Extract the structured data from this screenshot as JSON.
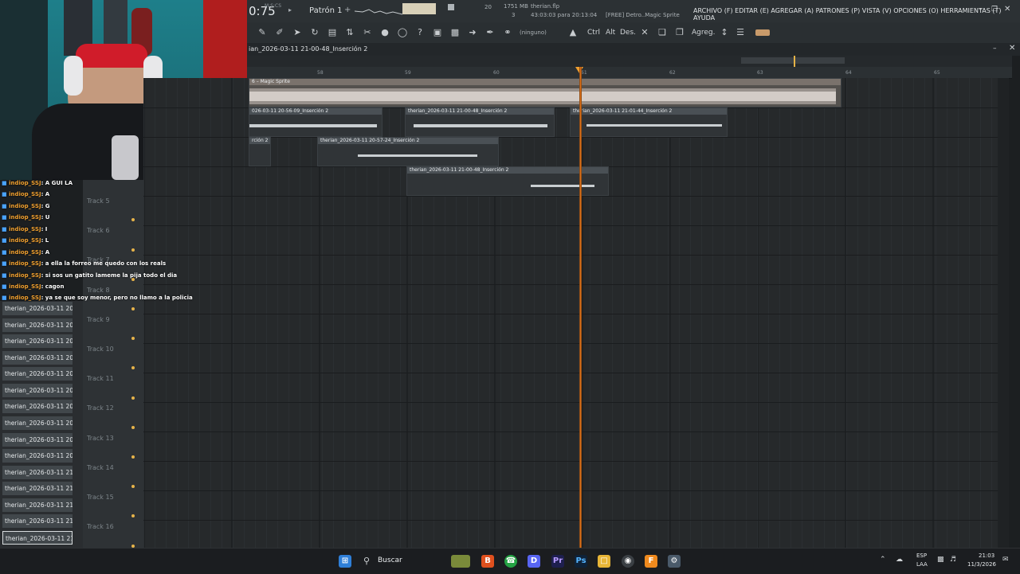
{
  "topbar": {
    "time": "0:75",
    "time_tag": "M:S:CS",
    "pattern": "Patrón 1",
    "pattern_add": "+",
    "cpu_num": "20",
    "memory": "1751 MB",
    "voices": "3",
    "file_name": "therian.flp",
    "file_time": "43:03:03 para 20:13:04",
    "plugin_info": "[FREE] Detro..Magic Sprite",
    "menu": "ARCHIVO (F) EDITAR (E) AGREGAR (A) PATRONES (P) VISTA (V) OPCIONES (O) HERRAMIENTAS (T) AYUDA"
  },
  "toolbar": {
    "mode": "(ninguno)",
    "ctrl": "Ctrl",
    "alt": "Alt",
    "des": "Des.",
    "agreg": "Agreg."
  },
  "playlist": {
    "title": "ian_2026-03-11 21-00-48_Inserción 2",
    "ruler": [
      "58",
      "59",
      "60",
      "61",
      "62",
      "63",
      "64",
      "65"
    ],
    "tracks": [
      "Track 5",
      "Track 6",
      "Track 7",
      "Track 8",
      "Track 9",
      "Track 10",
      "Track 11",
      "Track 12",
      "Track 13",
      "Track 14",
      "Track 15",
      "Track 16"
    ],
    "clips": {
      "magic": "6 – Magic Sprite",
      "c1": "026-03-11 20-56-09_Inserción 2",
      "c2": "therian_2026-03-11 21-00-48_Inserción 2",
      "c3": "therian_2026-03-11 21-01-44_Inserción 2",
      "c4": "rción 2",
      "c5": "therian_2026-03-11 20-57-24_Inserción 2",
      "c6": "therian_2026-03-11 21-00-48_Inserción 2"
    }
  },
  "browser": {
    "items": [
      "therian_2026-03-11 20-",
      "therian_2026-03-11 20-",
      "therian_2026-03-11 20-",
      "therian_2026-03-11 20-",
      "therian_2026-03-11 20-",
      "therian_2026-03-11 20-",
      "therian_2026-03-11 20-",
      "therian_2026-03-11 20-",
      "therian_2026-03-11 20-",
      "therian_2026-03-11 20-",
      "therian_2026-03-11 21-",
      "therian_2026-03-11 21-",
      "therian_2026-03-11 21-",
      "therian_2026-03-11 21-",
      "therian_2026-03-11 21-"
    ]
  },
  "chat": [
    {
      "user": "indiop_SSJ",
      "msg": ": A GUI LA"
    },
    {
      "user": "indiop_SSJ",
      "msg": ": A"
    },
    {
      "user": "indiop_SSJ",
      "msg": ": G"
    },
    {
      "user": "indiop_SSJ",
      "msg": ": U"
    },
    {
      "user": "indiop_SSJ",
      "msg": ": I"
    },
    {
      "user": "indiop_SSJ",
      "msg": ": L"
    },
    {
      "user": "indiop_SSJ",
      "msg": ": A"
    },
    {
      "user": "indiop_SSJ",
      "msg": ": a ella la forreo me quedo con los reals"
    },
    {
      "user": "indiop_SSJ",
      "msg": ": si sos un gatito lameme la pija todo el dia"
    },
    {
      "user": "indiop_SSJ",
      "msg": ": cagon"
    },
    {
      "user": "indiop_SSJ",
      "msg": ": ya se que soy menor, pero no llamo a la policia"
    }
  ],
  "taskbar": {
    "search": "Buscar",
    "lang": "ESP",
    "lang2": "LAA",
    "time": "21:03",
    "date": "11/3/2026"
  },
  "colors": {
    "playhead": "#f07a1c",
    "track_dot": "#e6b34a",
    "chat_user": "#f0a030"
  }
}
